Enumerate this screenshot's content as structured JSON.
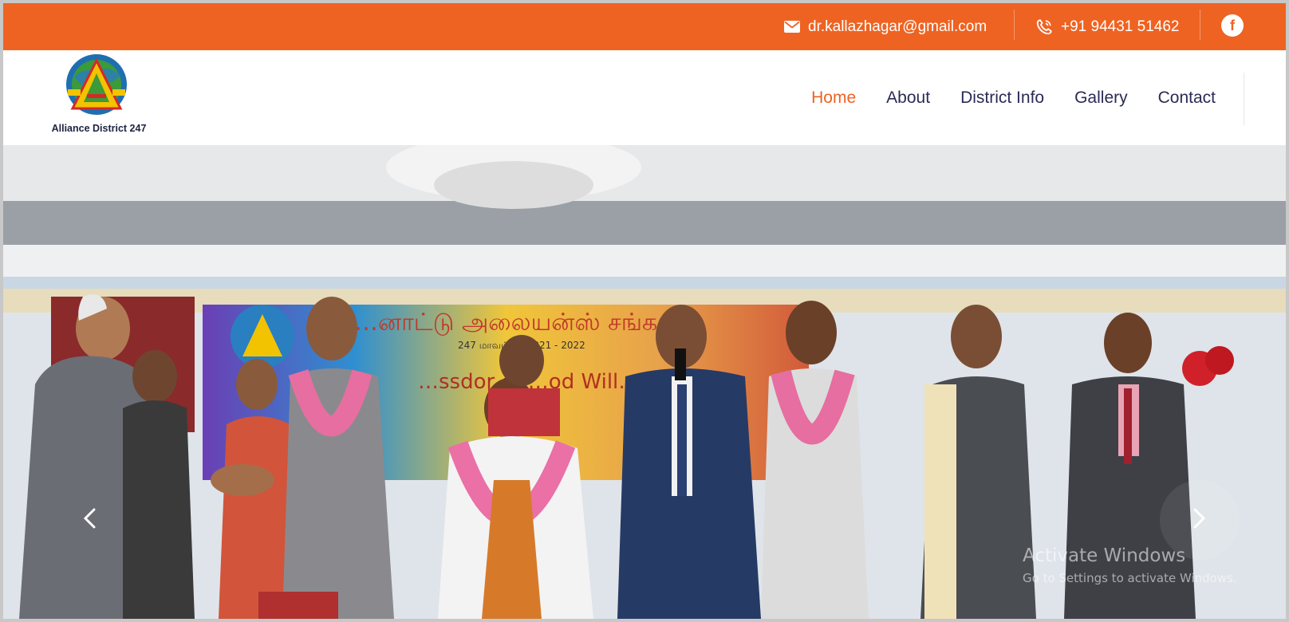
{
  "topbar": {
    "email": "dr.kallazhagar@gmail.com",
    "phone": "+91 94431 51462",
    "social_icon": "f",
    "email_icon": "envelope-icon",
    "phone_icon": "phone-icon",
    "facebook_icon": "facebook-icon"
  },
  "header": {
    "logo_caption": "Alliance District 247",
    "nav": [
      {
        "label": "Home",
        "active": true
      },
      {
        "label": "About",
        "active": false
      },
      {
        "label": "District Info",
        "active": false
      },
      {
        "label": "Gallery",
        "active": false
      },
      {
        "label": "Contact",
        "active": false
      }
    ]
  },
  "hero": {
    "banner_line1": "…னாட்டு அலையன்ஸ் சங்கங்…",
    "banner_line2": "247 மாவட்டம் 2021 - 2022",
    "banner_line3": "…ssdor of …od Will…",
    "prev_icon": "chevron-left-icon",
    "next_icon": "chevron-right-icon"
  },
  "watermark": {
    "title": "Activate Windows",
    "subtitle": "Go to Settings to activate Windows."
  },
  "colors": {
    "accent": "#ee6322",
    "nav_text": "#2b2b55",
    "logo_text": "#1d2340"
  }
}
